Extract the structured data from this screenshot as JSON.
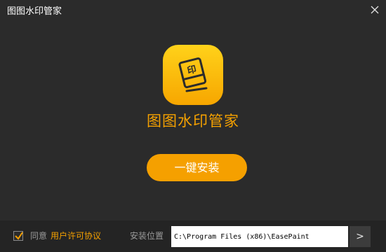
{
  "window": {
    "title": "图图水印管家"
  },
  "main": {
    "app_name": "图图水印管家",
    "icon_stamp_glyph": "印",
    "install_button_label": "一键安装"
  },
  "footer": {
    "agree_checked": true,
    "agree_label": "同意",
    "agreement_link_label": "用户许可协议",
    "install_path_label": "安装位置",
    "install_path_value": "C:\\Program Files (x86)\\EasePaint",
    "browse_button_label": ">"
  },
  "icons": {
    "close": "close-icon",
    "app": "stamp-eraser-icon",
    "check": "checkmark-icon"
  },
  "colors": {
    "background": "#2b2b2b",
    "footer_background": "#242424",
    "accent": "#f5a000",
    "icon_gradient_top": "#ffd21a",
    "icon_gradient_bottom": "#f7a600"
  }
}
